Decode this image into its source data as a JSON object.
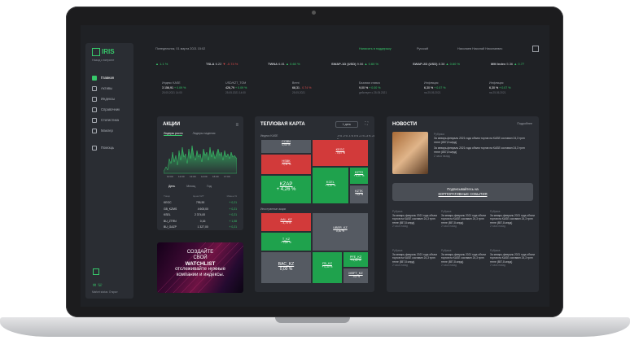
{
  "app": {
    "logo": "IRIS",
    "back_link": "Назад к витрине",
    "market_status": "Market status: Открыт"
  },
  "nav": [
    {
      "label": "Главная",
      "icon": "home-icon",
      "active": true
    },
    {
      "label": "Активы",
      "icon": "assets-icon"
    },
    {
      "label": "Индексы",
      "icon": "chart-icon"
    },
    {
      "label": "Справочник",
      "icon": "book-icon"
    },
    {
      "label": "Статистика",
      "icon": "stats-icon"
    },
    {
      "label": "Маклер",
      "icon": "broker-icon"
    },
    {
      "label": "Помощь",
      "icon": "help-icon"
    }
  ],
  "topbar": {
    "date": "Понедельник, 01 марта 2021 15:02",
    "support": "Написать в поддержку",
    "language": "Русский",
    "user": "Николаев Николай Николаевич"
  },
  "ticker": [
    {
      "name": "USD/KZT",
      "value": "",
      "change": "▲ 1.1 %",
      "dir": "up"
    },
    {
      "name": "TSLA",
      "value": "6.22",
      "change": "▼ -0.74 %",
      "dir": "down"
    },
    {
      "name": "TWNA",
      "value": "6.81",
      "change": "▲ 0.60 %",
      "dir": "up"
    },
    {
      "name": "SWAP-1D (USD)",
      "value": "9.06",
      "change": "▲ 0.60 %",
      "dir": "up"
    },
    {
      "name": "SWAP-2D (USD)",
      "value": "8.38",
      "change": "▲ 0.60 %",
      "dir": "up"
    },
    {
      "name": "MM Index",
      "value": "5.36",
      "change": "▲ 0.77",
      "dir": "up"
    }
  ],
  "indicators": [
    {
      "label": "Индекс KASE",
      "value": "3 156,91",
      "change": "+ 0.09 %",
      "date": "25.05.2021 14:00"
    },
    {
      "label": "USD/KZT_TOM",
      "value": "426,79",
      "change": "+ 0.09 %",
      "date": "25.05.2021 14:00"
    },
    {
      "label": "Brent",
      "value": "68,31",
      "change": "- 0.74 %",
      "date": "25.05.2021"
    },
    {
      "label": "Базовая ставка",
      "value": "9,00 %",
      "change": "+ 0.00 %",
      "date": "действует с 25.05.2021"
    },
    {
      "label": "Инфляция",
      "value": "6,30 %",
      "change": "+ 0.07 %",
      "date": "на 25.05.2021"
    },
    {
      "label": "Инфляция",
      "value": "6,30 %",
      "change": "+ 0.07 %",
      "date": "на 25.05.2021"
    }
  ],
  "shares": {
    "title": "АКЦИИ",
    "tabs": [
      "Лидеры роста",
      "Лидеры падения"
    ],
    "chart_times": [
      "10:00",
      "12:00",
      "13:00",
      "14:00",
      "16:00",
      "17:00"
    ],
    "periods": [
      "День",
      "Месяц",
      "Год"
    ],
    "columns": [
      "Тикер",
      "Цена KZT",
      "Измен.%"
    ],
    "rows": [
      {
        "ticker": "KEGC",
        "price": "795,90",
        "change": "+ 0,21"
      },
      {
        "ticker": "GB_KZMS",
        "price": "4 600,00",
        "change": "+ 0,21"
      },
      {
        "ticker": "KSEL",
        "price": "2 374,00",
        "change": "+ 0,21"
      },
      {
        "ticker": "BU_ZTRN",
        "price": "0,16",
        "change": "+ 1,08"
      },
      {
        "ticker": "BU_GAZP",
        "price": "1 327,00",
        "change": "+ 0,21"
      }
    ]
  },
  "watchlist": {
    "line1": "СОЗДАЙТЕ",
    "line2": "СВОЙ",
    "line3": "WATCHLIST",
    "line4": "отслеживайте нужные",
    "line5": "компании и индексы."
  },
  "heatmap": {
    "title": "ТЕПЛОВАЯ КАРТА",
    "period": "1 день",
    "sub1": "Индекс KASE",
    "sub2": "Иностранные акции",
    "legend": "-3 %  -2 %  -1 %  0 %  +1 %  +2 %  +3 %",
    "cells1": [
      {
        "name": "CCBN",
        "change": "0,00 %",
        "cls": "n"
      },
      {
        "name": "KEGC",
        "change": "- 0,67 %",
        "cls": "r"
      },
      {
        "name": "HSBK",
        "change": "- 0,11 %",
        "cls": "r"
      },
      {
        "name": "KZAP",
        "change": "+ 4,26 %",
        "cls": "g"
      },
      {
        "name": "KCEL",
        "change": "+ 0,37 %",
        "cls": "g"
      },
      {
        "name": "KZTO",
        "change": "+ 0,07 %",
        "cls": "g"
      },
      {
        "name": "KZTK",
        "change": "- 0,5 %",
        "cls": "n"
      }
    ],
    "cells2": [
      {
        "name": "AAL_KZ",
        "change": "- 4,75 %",
        "cls": "r"
      },
      {
        "name": "UBER_KZ",
        "change": "0,00 %",
        "cls": "n"
      },
      {
        "name": "T_KZ",
        "change": "+ 2,60 %",
        "cls": "g"
      },
      {
        "name": "BAC_KZ",
        "change": "0,00 %",
        "cls": "n"
      },
      {
        "name": "FB_KZ",
        "change": "+ 0,30 %",
        "cls": "g"
      },
      {
        "name": "PFE_KZ",
        "change": "+ 0,02 %",
        "cls": "g"
      },
      {
        "name": "MSFT_KZ",
        "change": "- 0,5 %",
        "cls": "n"
      }
    ]
  },
  "news": {
    "title": "НОВОСТИ",
    "all": "Подробнее",
    "main": {
      "rubric": "Рубрика",
      "text": "За январь-февраль 2021 года объем торгов на KASE составил 24,3 трлн тенге (857,8 млрд)",
      "text2": "За январь-февраль 2021 года объем торгов на KASE составил 24,3 трлн тенге (857,8 млрд)",
      "ago": "2 часа назад"
    },
    "subscribe1": "Подписывайтесь на",
    "subscribe2": "КОРПОРАТИВНЫЕ СОБЫТИЯ",
    "items": [
      {
        "rubric": "Рубрика",
        "text": "За январь-февраль 2021 года объем торгов на KASE составил 24,3 трлн тенге (857,8 млрд)",
        "ago": "2 часа назад"
      },
      {
        "rubric": "Рубрика",
        "text": "За январь-февраль 2021 года объем торгов на KASE составил 24,3 трлн тенге (857,8 млрд)",
        "ago": "2 часа назад"
      },
      {
        "rubric": "Рубрика",
        "text": "За январь-февраль 2021 года объем торгов на KASE составил 24,3 трлн тенге (857,8 млрд)",
        "ago": "2 часа назад"
      },
      {
        "rubric": "Рубрика",
        "text": "За январь-февраль 2021 года объем торгов на KASE составил 24,3 трлн тенге (857,8 млрд)",
        "ago": "2 часа назад"
      },
      {
        "rubric": "Рубрика",
        "text": "За январь-февраль 2021 года объем торгов на KASE составил 24,3 трлн тенге (857,8 млрд)",
        "ago": "2 часа назад"
      },
      {
        "rubric": "Рубрика",
        "text": "За январь-февраль 2021 года объем торгов на KASE составил 24,3 трлн тенге (857,8 млрд)",
        "ago": "2 часа назад"
      }
    ]
  },
  "colors": {
    "accent": "#37c96b",
    "negative": "#e04b4b",
    "background": "#1f2125",
    "card": "#2a2d33"
  }
}
